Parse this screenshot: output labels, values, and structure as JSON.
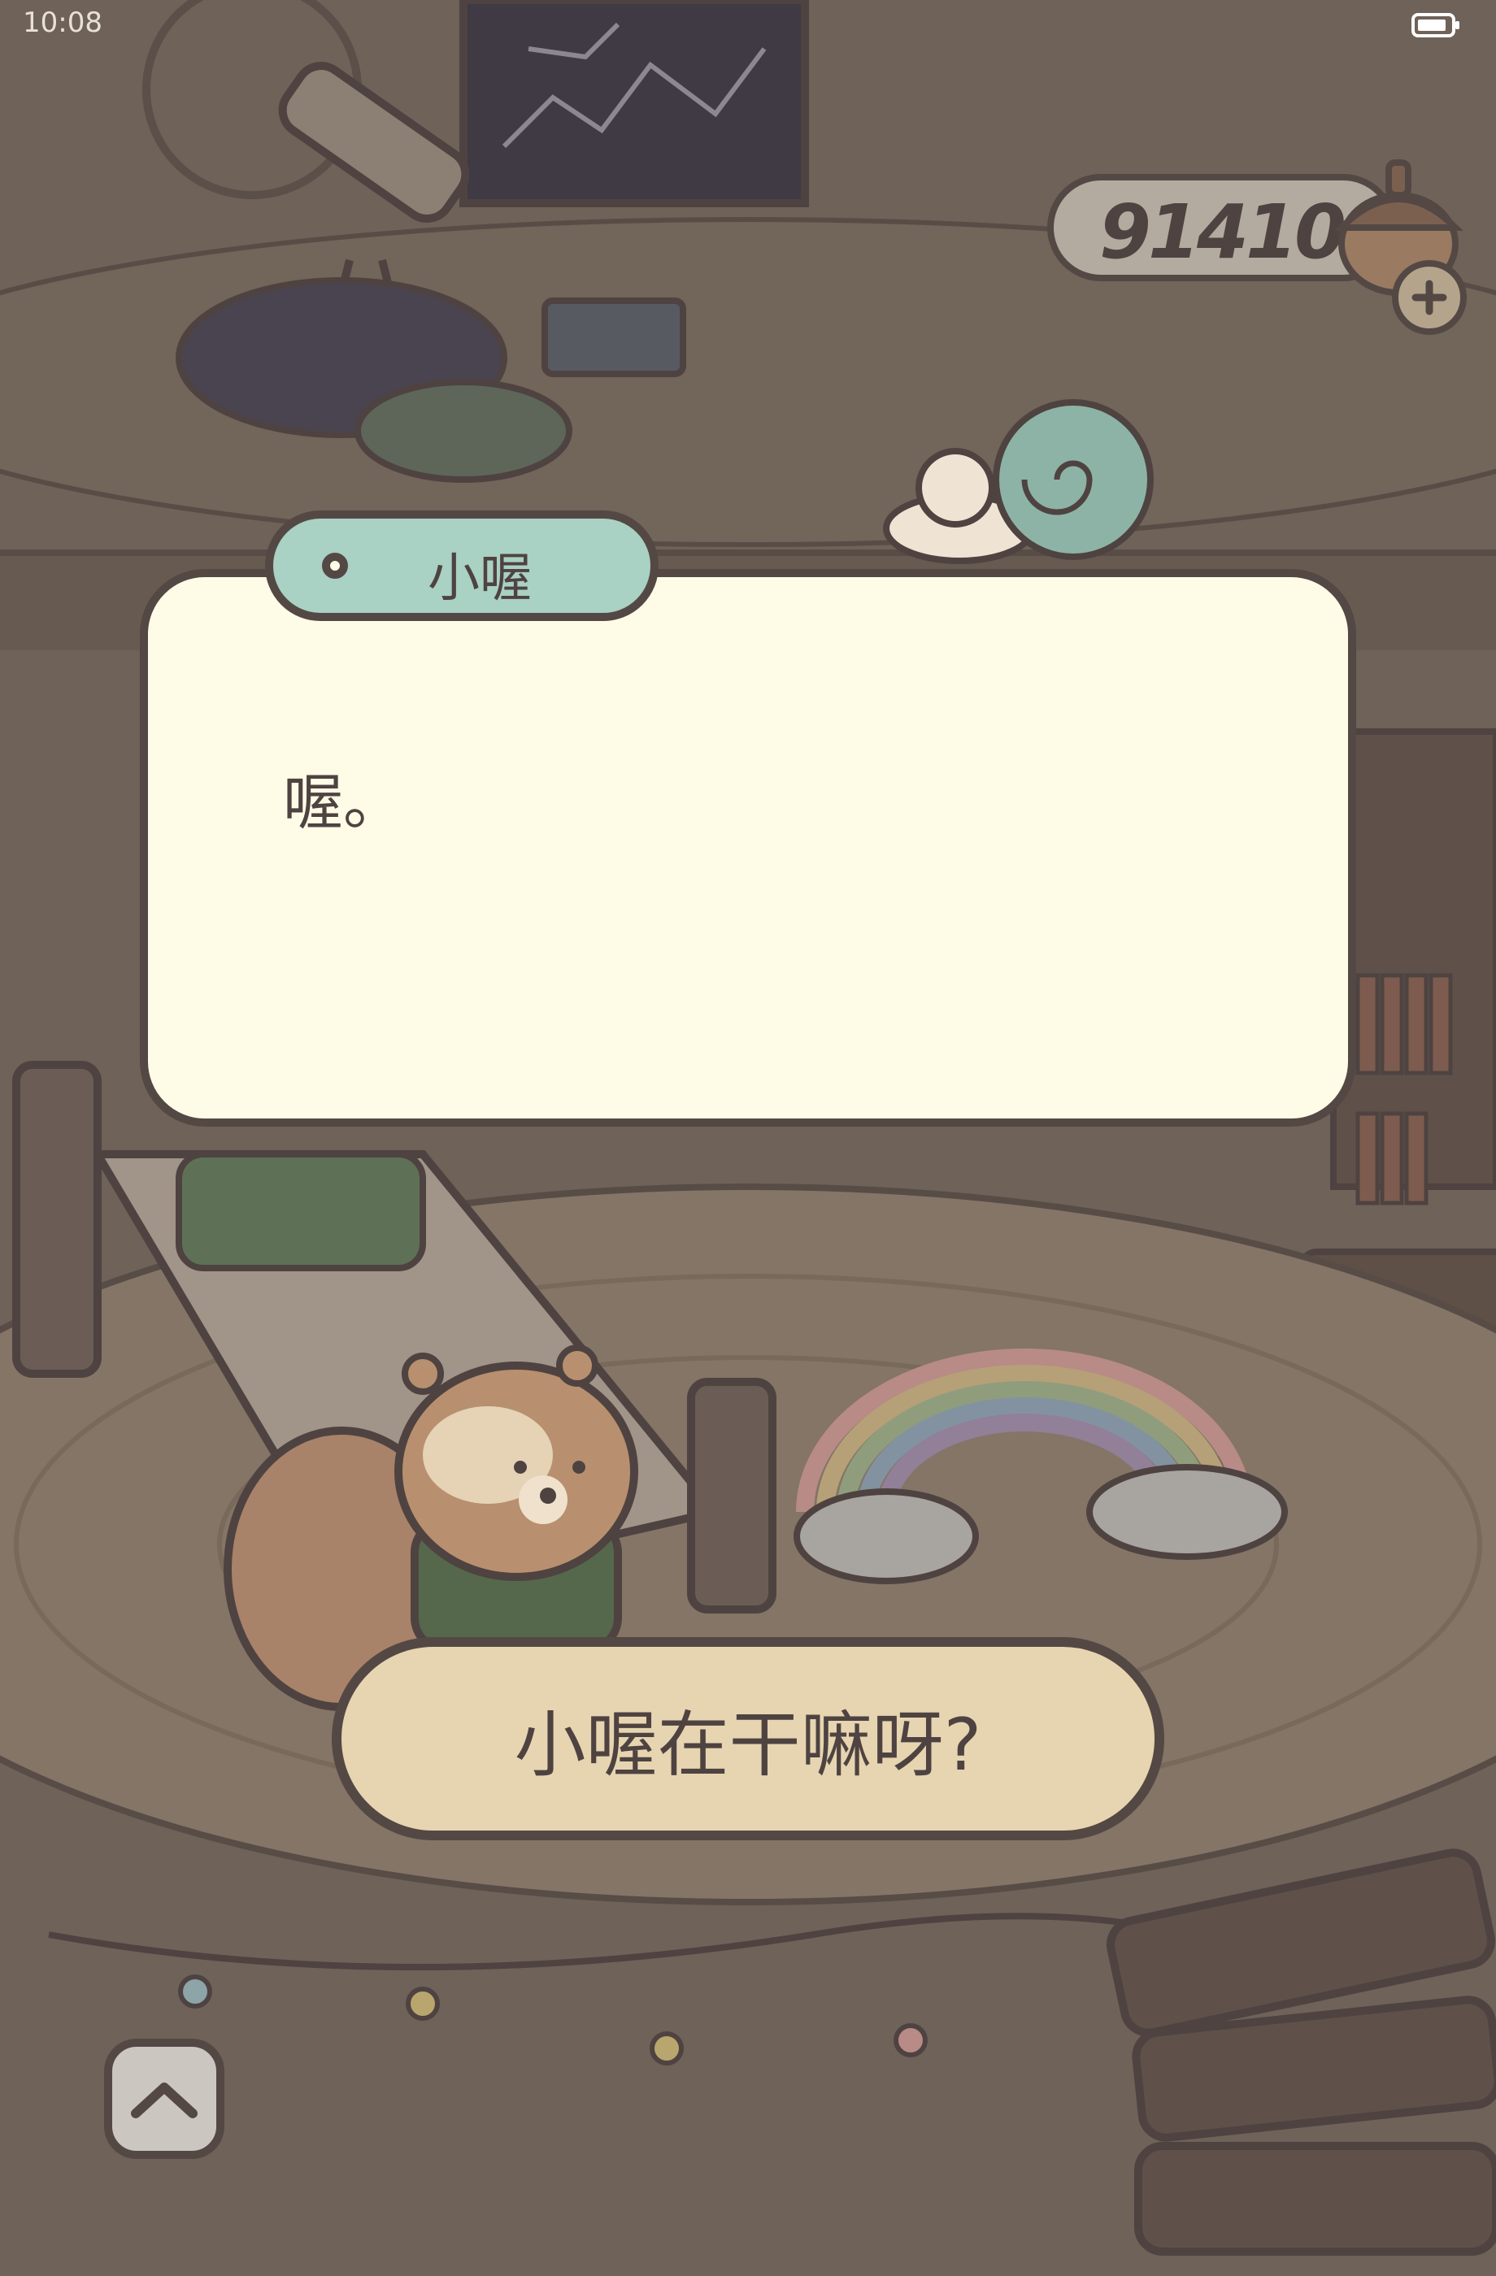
{
  "status_bar": {
    "time": "10:08",
    "battery_icon": "battery-icon"
  },
  "currency": {
    "amount": "91410",
    "icon": "acorn-icon",
    "add_icon": "plus-icon"
  },
  "dialog": {
    "speaker": "小喔",
    "speaker_icon": "speaker-dot-icon",
    "text": "喔。"
  },
  "choice": {
    "label": "小喔在干嘛呀?"
  },
  "navigation": {
    "expand_icon": "chevron-up-icon"
  },
  "colors": {
    "background": "#6e6259",
    "outline": "#544845",
    "dialog_bg": "#fefbe6",
    "name_tag": "#a9d1c4",
    "choice_bg": "#e7d5b1"
  }
}
